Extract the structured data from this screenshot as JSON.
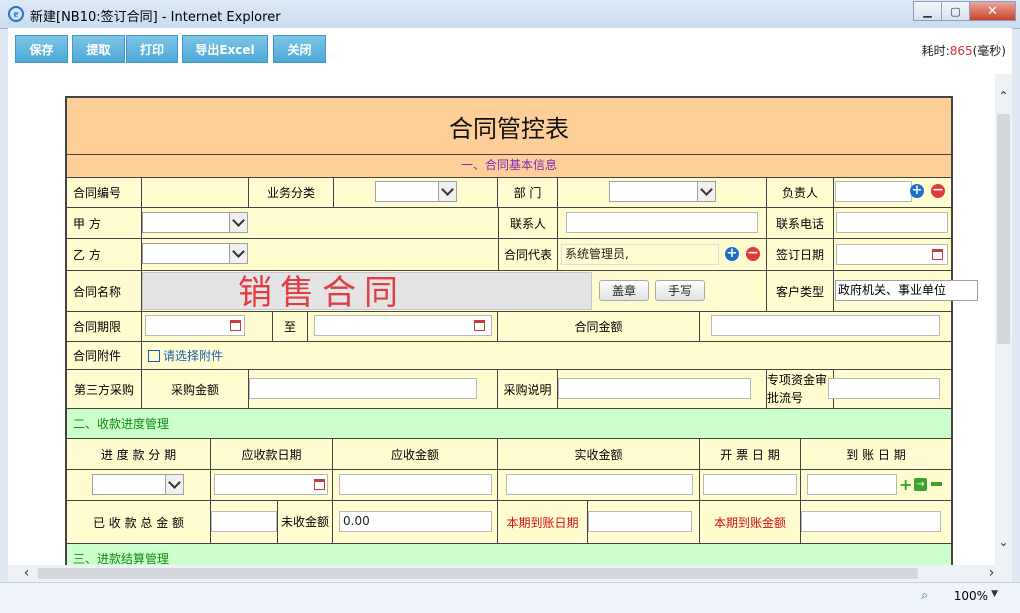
{
  "window": {
    "title": "新建[NB10:签订合同] - Internet Explorer",
    "ie_icon": "e"
  },
  "toolbar": {
    "buttons": [
      "保存",
      "提取",
      "打印",
      "导出Excel",
      "关闭"
    ],
    "elapsed_label": "耗时:",
    "elapsed_value": "865",
    "elapsed_unit": "(毫秒)"
  },
  "form": {
    "title": "合同管控表",
    "section1": "一、合同基本信息",
    "labels": {
      "contract_no": "合同编号",
      "business_type": "业务分类",
      "department": "部  门",
      "owner": "负责人",
      "party_a": "甲  方",
      "contact": "联系人",
      "contact_phone": "联系电话",
      "party_b": "乙  方",
      "contract_rep": "合同代表",
      "sign_date": "签订日期",
      "contract_name": "合同名称",
      "customer_type": "客户类型",
      "contract_period": "合同期限",
      "to": "至",
      "contract_amount": "合同金额",
      "attachment": "合同附件",
      "third_party": "第三方采购",
      "purchase_amount": "采购金额",
      "purchase_note": "采购说明",
      "special_fund": "专项资金审批流号"
    },
    "values": {
      "contract_rep": "系统管理员,",
      "customer_type": "政府机关、事业单位",
      "attachment_link": "请选择附件",
      "stamp_button": "盖章",
      "handwrite_button": "手写",
      "stamp_text": "销售合同"
    },
    "section2": "二、收款进度管理",
    "progress_headers": [
      "进 度 款 分 期",
      "应收款日期",
      "应收金额",
      "实收金额",
      "开 票 日 期",
      "到 账 日 期"
    ],
    "totals": {
      "received_total_label": "已 收 款 总 金 额",
      "unreceived_label": "未收金额",
      "unreceived_value": "0.00",
      "arrival_date_label": "本期到账日期",
      "arrival_amount_label": "本期到账金额"
    },
    "section3": "三、进款结算管理"
  },
  "status": {
    "zoom": "100%"
  },
  "colors": {
    "header": "#ffcf99",
    "form_bg": "#fffcd0",
    "section_green": "#ccffcc",
    "button": "#4da8d8"
  }
}
